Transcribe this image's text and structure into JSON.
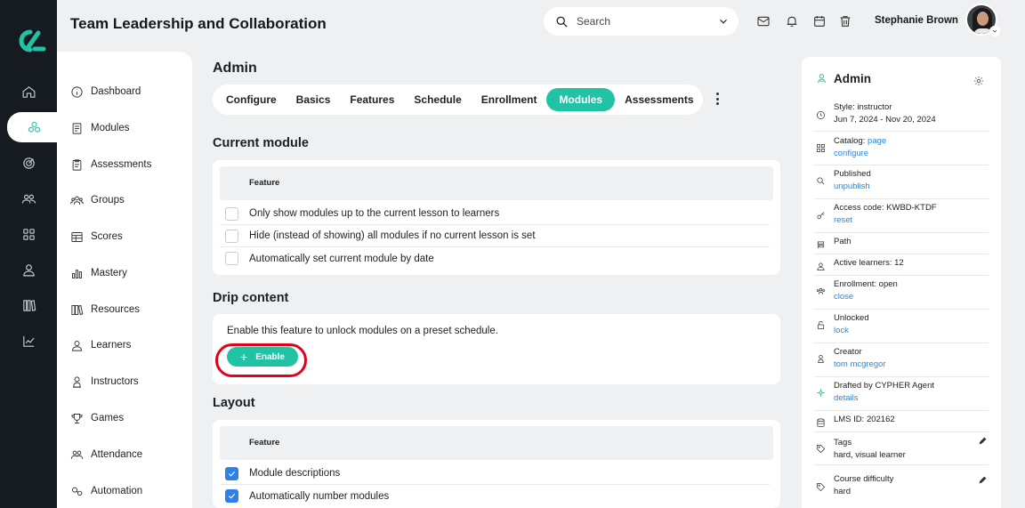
{
  "header": {
    "title": "Team Leadership and Collaboration",
    "search_placeholder": "Search",
    "user_name": "Stephanie Brown"
  },
  "sidebar": {
    "items": [
      {
        "label": "Dashboard",
        "icon": "info-circle-icon"
      },
      {
        "label": "Modules",
        "icon": "document-icon"
      },
      {
        "label": "Assessments",
        "icon": "clipboard-icon"
      },
      {
        "label": "Groups",
        "icon": "group-icon"
      },
      {
        "label": "Scores",
        "icon": "table-icon"
      },
      {
        "label": "Mastery",
        "icon": "bar-chart-icon"
      },
      {
        "label": "Resources",
        "icon": "books-icon"
      },
      {
        "label": "Learners",
        "icon": "person-icon"
      },
      {
        "label": "Instructors",
        "icon": "instructor-icon"
      },
      {
        "label": "Games",
        "icon": "trophy-icon"
      },
      {
        "label": "Attendance",
        "icon": "attendance-icon"
      },
      {
        "label": "Automation",
        "icon": "automation-icon"
      }
    ]
  },
  "main": {
    "page_title": "Admin",
    "tabs": [
      {
        "label": "Configure",
        "active": false
      },
      {
        "label": "Basics",
        "active": false
      },
      {
        "label": "Features",
        "active": false
      },
      {
        "label": "Schedule",
        "active": false
      },
      {
        "label": "Enrollment",
        "active": false
      },
      {
        "label": "Modules",
        "active": true
      },
      {
        "label": "Assessments",
        "active": false
      }
    ],
    "current_module": {
      "title": "Current module",
      "column_header": "Feature",
      "rows": [
        {
          "label": "Only show modules up to the current lesson to learners",
          "checked": false
        },
        {
          "label": "Hide (instead of showing) all modules if no current lesson is set",
          "checked": false
        },
        {
          "label": "Automatically set current module by date",
          "checked": false
        }
      ]
    },
    "drip_content": {
      "title": "Drip content",
      "description": "Enable this feature to unlock modules on a preset schedule.",
      "enable_label": "Enable"
    },
    "layout": {
      "title": "Layout",
      "column_header": "Feature",
      "rows": [
        {
          "label": "Module descriptions",
          "checked": true
        },
        {
          "label": "Automatically number modules",
          "checked": true
        }
      ]
    }
  },
  "panel": {
    "title": "Admin",
    "style": "Style: instructor",
    "dates": "Jun 7, 2024 - Nov 20, 2024",
    "catalog_label": "Catalog:",
    "catalog_link": "page",
    "catalog_configure": "configure",
    "published": "Published",
    "unpublish": "unpublish",
    "access_code": "Access code: KWBD-KTDF",
    "reset": "reset",
    "path": "Path",
    "active_learners": "Active learners: 12",
    "enrollment": "Enrollment: open",
    "close": "close",
    "unlocked": "Unlocked",
    "lock": "lock",
    "creator_label": "Creator",
    "creator": "tom mcgregor",
    "drafted": "Drafted by CYPHER Agent",
    "details": "details",
    "lms_id": "LMS ID: 202162",
    "tags_label": "Tags",
    "tags": "hard, visual learner",
    "difficulty_label": "Course difficulty",
    "difficulty": "hard"
  },
  "colors": {
    "accent": "#22c3a4",
    "rail": "#161b22",
    "link": "#2d86d9",
    "checkbox": "#2f80ed",
    "highlight": "#e3001b"
  }
}
